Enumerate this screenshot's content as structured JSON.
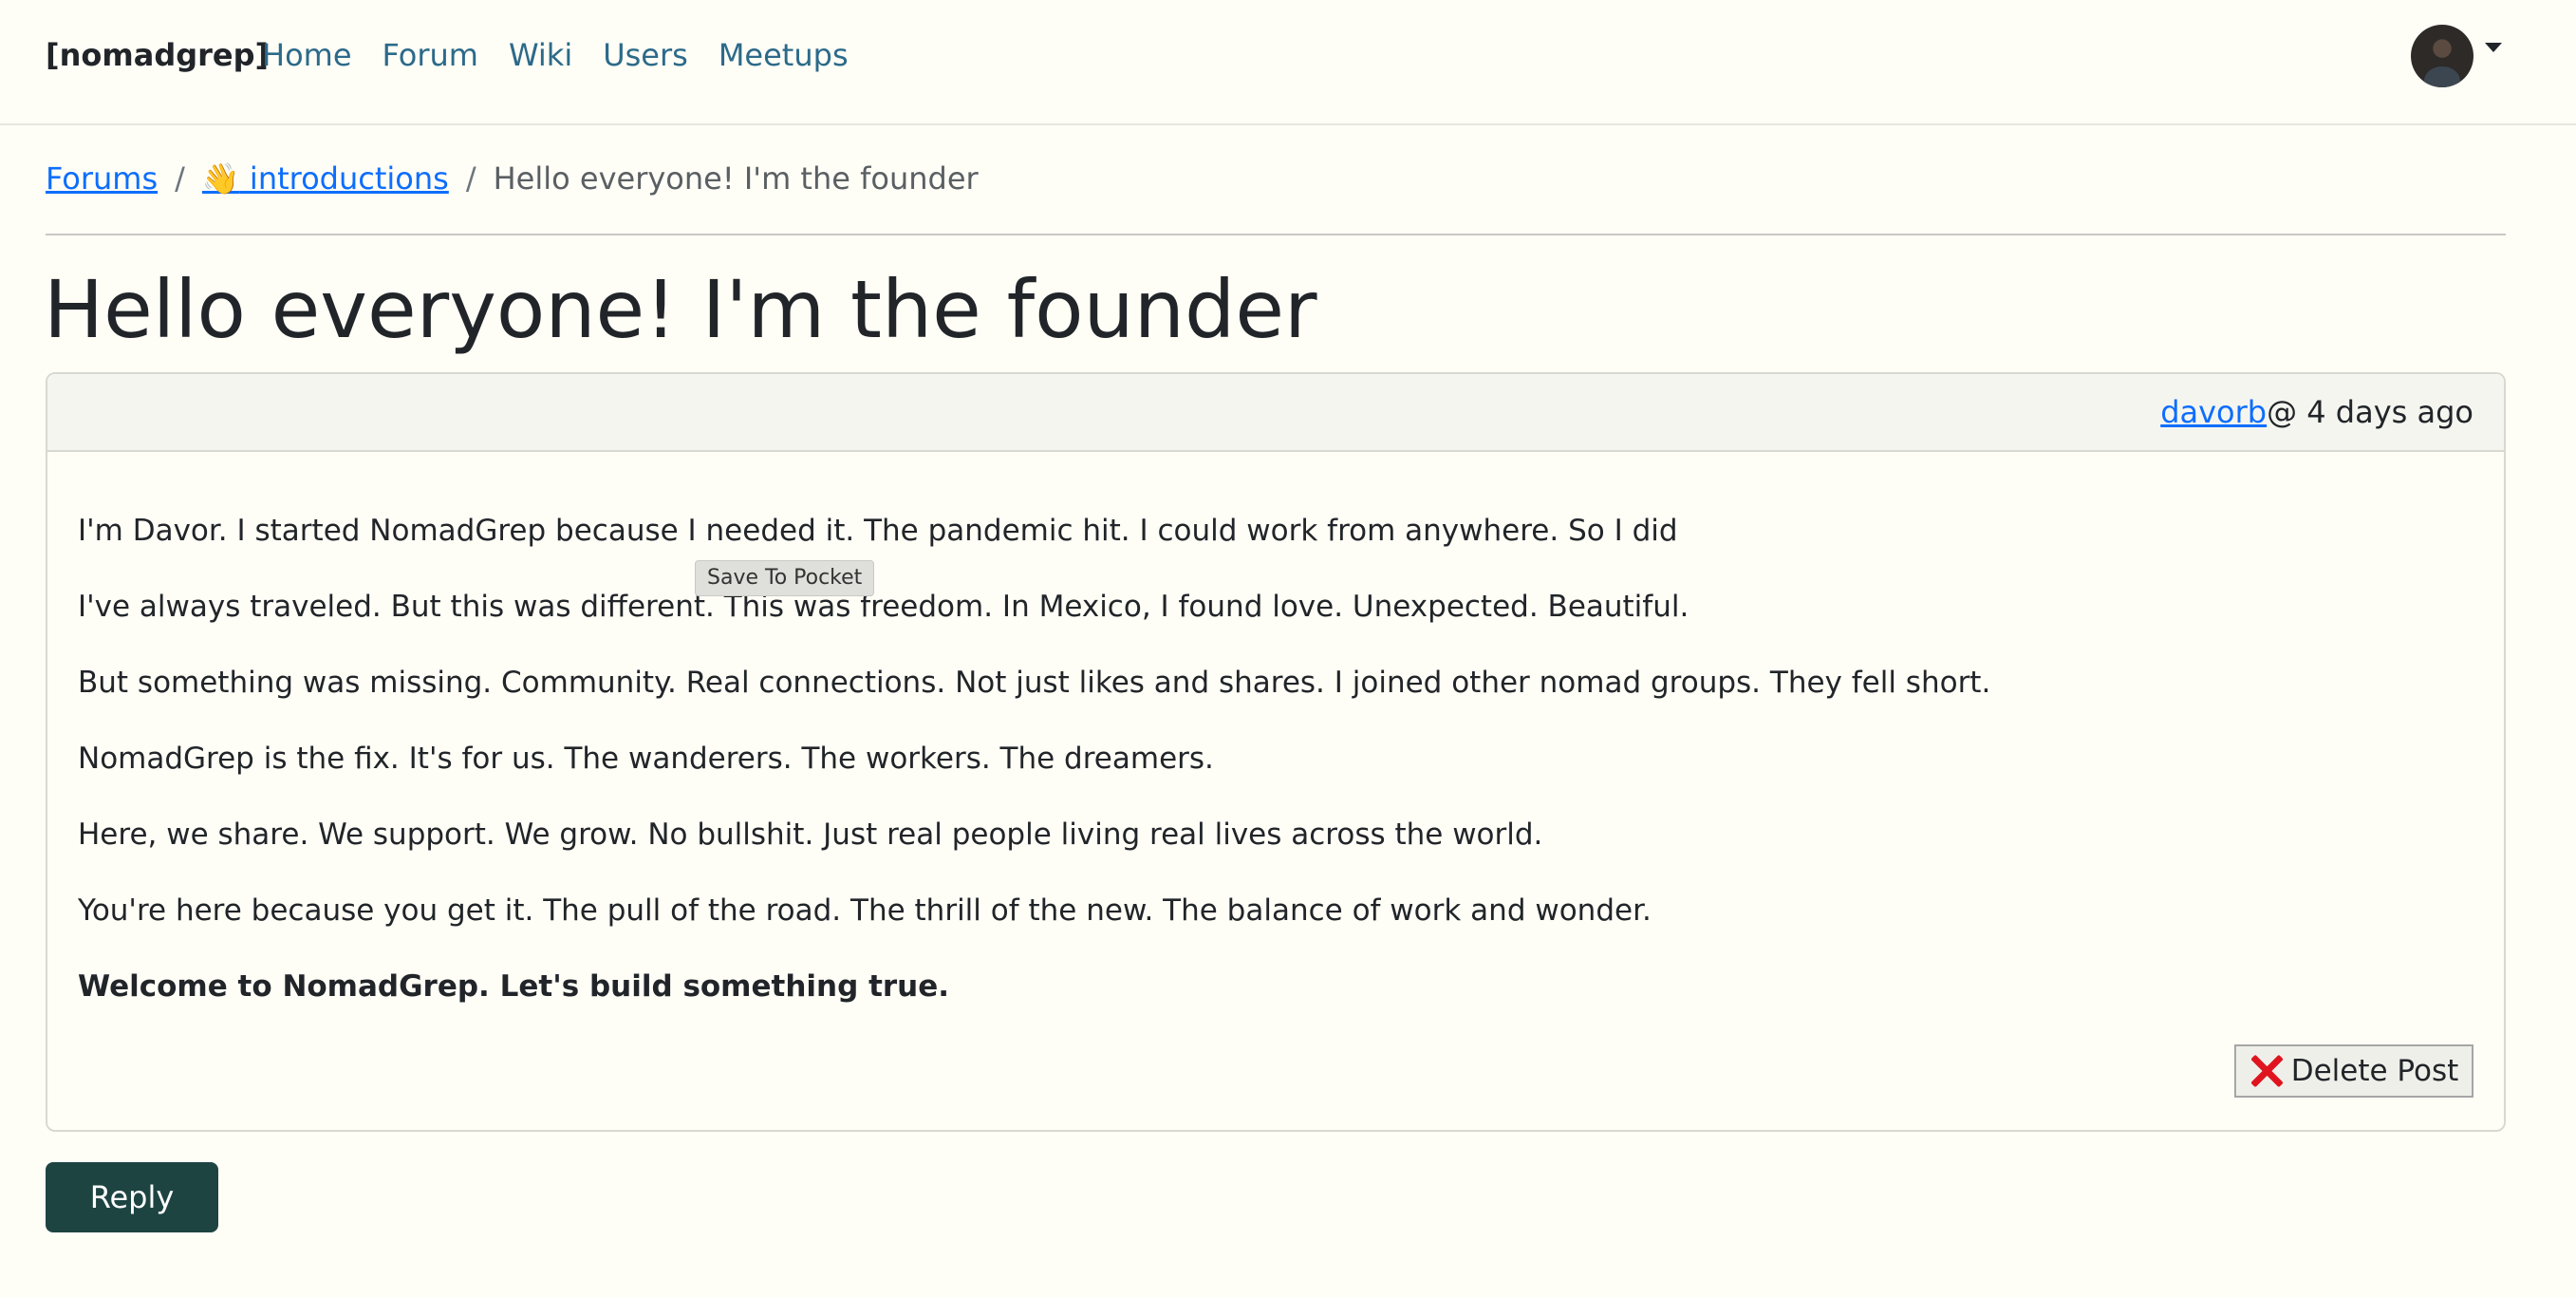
{
  "navbar": {
    "brand": "[nomadgrep]",
    "links": [
      "Home",
      "Forum",
      "Wiki",
      "Users",
      "Meetups"
    ],
    "avatar_icon": "user-avatar-photo"
  },
  "breadcrumb": {
    "forums": "Forums",
    "category_emoji": "👋",
    "category": " introductions",
    "current": "Hello everyone! I'm the founder",
    "separator": "/"
  },
  "post": {
    "title": "Hello everyone! I'm the founder",
    "author": "davorb",
    "meta": " @ 4 days ago",
    "paragraphs": [
      "I'm Davor. I started NomadGrep because I needed it. The pandemic hit. I could work from anywhere. So I did",
      "I've always traveled. But this was different. This was freedom. In Mexico, I found love. Unexpected. Beautiful.",
      "But something was missing. Community. Real connections. Not just likes and shares. I joined other nomad groups. They fell short.",
      "NomadGrep is the fix. It's for us. The wanderers. The workers. The dreamers.",
      "Here, we share. We support. We grow. No bullshit. Just real people living real lives across the world.",
      "You're here because you get it. The pull of the road. The thrill of the new. The balance of work and wonder.",
      "Welcome to NomadGrep. Let's build something true."
    ],
    "tooltip": "Save To Pocket",
    "delete_label": "Delete Post",
    "delete_icon": "red-x-icon"
  },
  "actions": {
    "reply_label": "Reply"
  }
}
